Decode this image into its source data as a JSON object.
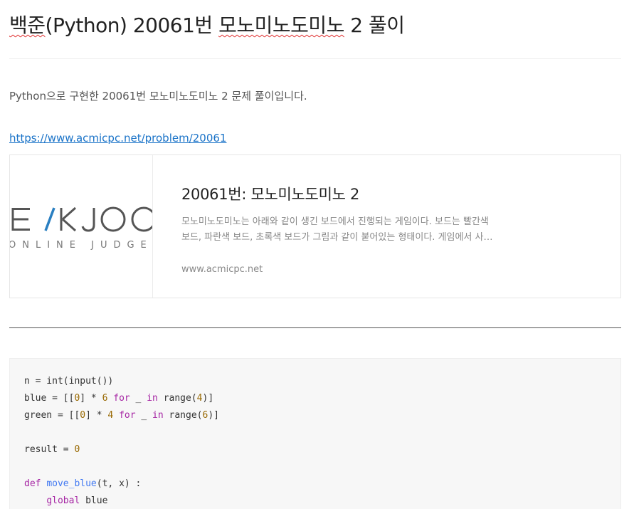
{
  "post": {
    "title_prefix": "백준(Python) 20061번 ",
    "title_spell": "모노미노도미노",
    "title_suffix": " 2 풀이",
    "title_first": "백준",
    "title_rest": "(Python) 20061번 ",
    "intro": "Python으로 구현한 20061번 모노미노도미노 2 문제 풀이입니다.",
    "link": "https://www.acmicpc.net/problem/20061"
  },
  "card": {
    "logo_text": "BAEKJOON",
    "logo_visible": "EKJOO",
    "logo_sub": "ONLINE JUDGE",
    "title": "20061번: 모노미노도미노 2",
    "desc_line1": "모노미노도미노는 아래와 같이 생긴 보드에서 진행되는 게임이다. 보드는 빨간색",
    "desc_line2": "보드, 파란색 보드, 초록색 보드가 그림과 같이 붙어있는 형태이다. 게임에서 사…",
    "domain": "www.acmicpc.net"
  },
  "code": {
    "colors": {
      "keyword": "#a626a4",
      "number": "#986801",
      "function": "#4078f2"
    },
    "lines": [
      [
        {
          "t": "n = int(input())",
          "c": ""
        }
      ],
      [
        {
          "t": "blue = [[",
          "c": ""
        },
        {
          "t": "0",
          "c": "num"
        },
        {
          "t": "] * ",
          "c": ""
        },
        {
          "t": "6",
          "c": "num"
        },
        {
          "t": " ",
          "c": ""
        },
        {
          "t": "for",
          "c": "kw"
        },
        {
          "t": " _ ",
          "c": ""
        },
        {
          "t": "in",
          "c": "kw"
        },
        {
          "t": " range(",
          "c": ""
        },
        {
          "t": "4",
          "c": "num"
        },
        {
          "t": ")]",
          "c": ""
        }
      ],
      [
        {
          "t": "green = [[",
          "c": ""
        },
        {
          "t": "0",
          "c": "num"
        },
        {
          "t": "] * ",
          "c": ""
        },
        {
          "t": "4",
          "c": "num"
        },
        {
          "t": " ",
          "c": ""
        },
        {
          "t": "for",
          "c": "kw"
        },
        {
          "t": " _ ",
          "c": ""
        },
        {
          "t": "in",
          "c": "kw"
        },
        {
          "t": " range(",
          "c": ""
        },
        {
          "t": "6",
          "c": "num"
        },
        {
          "t": ")]",
          "c": ""
        }
      ],
      [
        {
          "t": "",
          "c": ""
        }
      ],
      [
        {
          "t": "result = ",
          "c": ""
        },
        {
          "t": "0",
          "c": "num"
        }
      ],
      [
        {
          "t": "",
          "c": ""
        }
      ],
      [
        {
          "t": "def",
          "c": "kw"
        },
        {
          "t": " ",
          "c": ""
        },
        {
          "t": "move_blue",
          "c": "fn"
        },
        {
          "t": "(t, x) :",
          "c": ""
        }
      ],
      [
        {
          "t": "    ",
          "c": ""
        },
        {
          "t": "global",
          "c": "kw"
        },
        {
          "t": " blue",
          "c": ""
        }
      ]
    ]
  }
}
